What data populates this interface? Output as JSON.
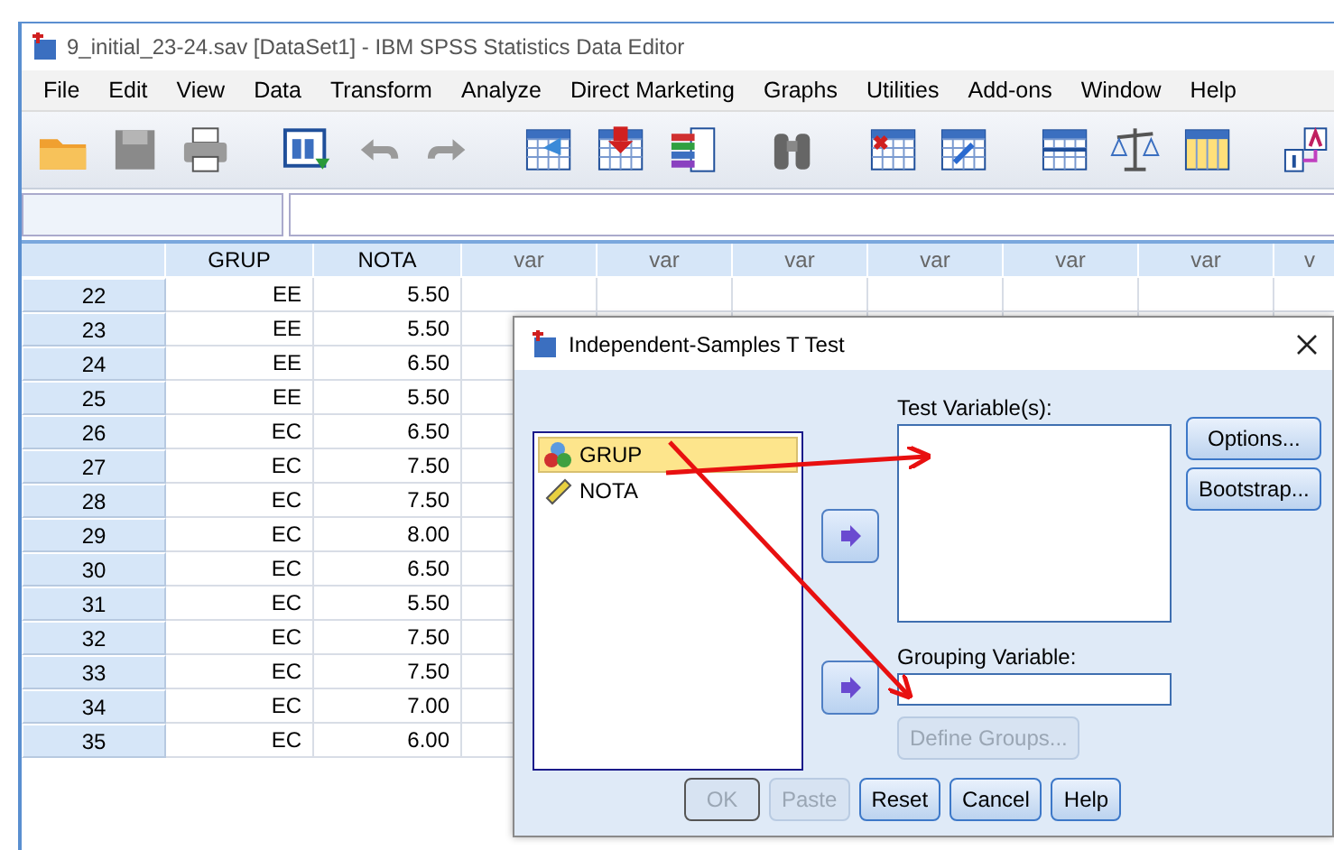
{
  "window": {
    "title": "9_initial_23-24.sav [DataSet1] - IBM SPSS Statistics Data Editor"
  },
  "menu": [
    "File",
    "Edit",
    "View",
    "Data",
    "Transform",
    "Analyze",
    "Direct Marketing",
    "Graphs",
    "Utilities",
    "Add-ons",
    "Window",
    "Help"
  ],
  "table": {
    "columns": [
      "GRUP",
      "NOTA",
      "var",
      "var",
      "var",
      "var",
      "var",
      "var",
      "v"
    ],
    "rows": [
      {
        "number": "22",
        "grup": "EE",
        "nota": "5.50"
      },
      {
        "number": "23",
        "grup": "EE",
        "nota": "5.50"
      },
      {
        "number": "24",
        "grup": "EE",
        "nota": "6.50"
      },
      {
        "number": "25",
        "grup": "EE",
        "nota": "5.50"
      },
      {
        "number": "26",
        "grup": "EC",
        "nota": "6.50"
      },
      {
        "number": "27",
        "grup": "EC",
        "nota": "7.50"
      },
      {
        "number": "28",
        "grup": "EC",
        "nota": "7.50"
      },
      {
        "number": "29",
        "grup": "EC",
        "nota": "8.00"
      },
      {
        "number": "30",
        "grup": "EC",
        "nota": "6.50"
      },
      {
        "number": "31",
        "grup": "EC",
        "nota": "5.50"
      },
      {
        "number": "32",
        "grup": "EC",
        "nota": "7.50"
      },
      {
        "number": "33",
        "grup": "EC",
        "nota": "7.50"
      },
      {
        "number": "34",
        "grup": "EC",
        "nota": "7.00"
      },
      {
        "number": "35",
        "grup": "EC",
        "nota": "6.00"
      }
    ]
  },
  "dialog": {
    "title": "Independent-Samples T Test",
    "variables": [
      {
        "name": "GRUP",
        "kind": "nominal",
        "selected": true
      },
      {
        "name": "NOTA",
        "kind": "scale",
        "selected": false
      }
    ],
    "test_variables_label": "Test Variable(s):",
    "grouping_variable_label": "Grouping Variable:",
    "define_groups": {
      "label": "Define Groups...",
      "disabled": true
    },
    "side_buttons": [
      {
        "label": "Options...",
        "disabled": false
      },
      {
        "label": "Bootstrap...",
        "disabled": false
      }
    ],
    "buttons": [
      {
        "label": "OK",
        "disabled": true
      },
      {
        "label": "Paste",
        "disabled": true
      },
      {
        "label": "Reset",
        "disabled": false
      },
      {
        "label": "Cancel",
        "disabled": false
      },
      {
        "label": "Help",
        "disabled": false
      }
    ]
  }
}
